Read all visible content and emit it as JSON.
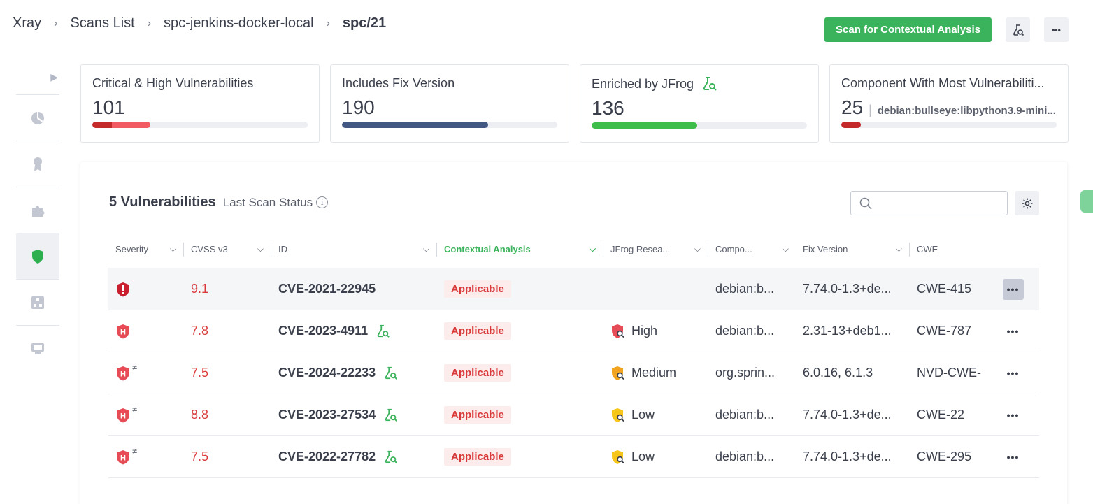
{
  "breadcrumb": [
    "Xray",
    "Scans List",
    "spc-jenkins-docker-local",
    "spc/21"
  ],
  "header": {
    "scan_button": "Scan for Contextual Analysis",
    "more": "•••"
  },
  "cards": [
    {
      "title": "Critical & High Vulnerabilities",
      "value": "101",
      "segments": [
        {
          "color": "#c42a2a",
          "fraction": 0.09
        },
        {
          "color": "#f25b61",
          "fraction": 0.27
        }
      ]
    },
    {
      "title": "Includes Fix Version",
      "value": "190",
      "segments": [
        {
          "color": "#425782",
          "fraction": 0.68
        }
      ]
    },
    {
      "title": "Enriched by JFrog",
      "value": "136",
      "icon": "flask-search-icon",
      "segments": [
        {
          "color": "#3fbd4a",
          "fraction": 0.49
        }
      ]
    },
    {
      "title": "Component With Most Vulnerabiliti...",
      "value": "25",
      "sub": "debian:bullseye:libpython3.9-mini...",
      "segments": [
        {
          "color": "#c42a2a",
          "fraction": 0.09
        }
      ]
    }
  ],
  "table": {
    "count_label": "5 Vulnerabilities",
    "status_label": "Last Scan Status",
    "search_placeholder": "",
    "columns": [
      "Severity",
      "CVSS v3",
      "ID",
      "Contextual Analysis",
      "JFrog Resea...",
      "Compo...",
      "Fix Version",
      "CWE"
    ],
    "rows": [
      {
        "severity": "critical",
        "cvss": "9.1",
        "id": "CVE-2021-22945",
        "enriched": false,
        "ca": "Applicable",
        "jfrog": "",
        "jfrog_level": "",
        "component": "debian:b...",
        "fix": "7.74.0-1.3+de...",
        "cwe": "CWE-415",
        "neq": false
      },
      {
        "severity": "high",
        "cvss": "7.8",
        "id": "CVE-2023-4911",
        "enriched": true,
        "ca": "Applicable",
        "jfrog": "High",
        "jfrog_level": "high",
        "component": "debian:b...",
        "fix": "2.31-13+deb1...",
        "cwe": "CWE-787",
        "neq": false
      },
      {
        "severity": "high",
        "cvss": "7.5",
        "id": "CVE-2024-22233",
        "enriched": true,
        "ca": "Applicable",
        "jfrog": "Medium",
        "jfrog_level": "medium",
        "component": "org.sprin...",
        "fix": "6.0.16, 6.1.3",
        "cwe": "NVD-CWE-",
        "neq": true
      },
      {
        "severity": "high",
        "cvss": "8.8",
        "id": "CVE-2023-27534",
        "enriched": true,
        "ca": "Applicable",
        "jfrog": "Low",
        "jfrog_level": "low",
        "component": "debian:b...",
        "fix": "7.74.0-1.3+de...",
        "cwe": "CWE-22",
        "neq": true
      },
      {
        "severity": "high",
        "cvss": "7.5",
        "id": "CVE-2022-27782",
        "enriched": true,
        "ca": "Applicable",
        "jfrog": "Low",
        "jfrog_level": "low",
        "component": "debian:b...",
        "fix": "7.74.0-1.3+de...",
        "cwe": "CWE-295",
        "neq": true
      }
    ]
  },
  "rail": [
    "pie-chart-icon",
    "badge-icon",
    "puzzle-icon",
    "shield-icon",
    "sitemap-icon",
    "server-icon"
  ],
  "colors": {
    "green": "#3bb35c",
    "critical": "#c81e2e",
    "high": "#e74c56",
    "medium": "#f0a420",
    "low": "#f5c518"
  }
}
